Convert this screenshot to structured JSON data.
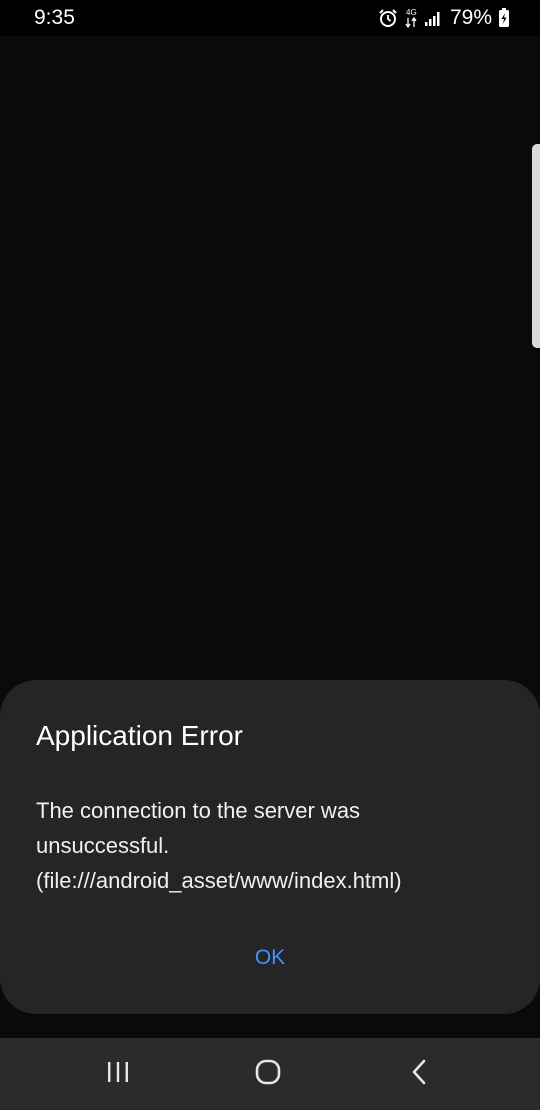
{
  "status_bar": {
    "time": "9:35",
    "battery_percent": "79%",
    "icons": [
      "alarm-icon",
      "data-transfer-icon",
      "signal-icon",
      "battery-charging-icon"
    ]
  },
  "dialog": {
    "title": "Application Error",
    "message_lines": [
      "The connection to the server was",
      "unsuccessful.",
      "(file:///android_asset/www/index.html)"
    ],
    "ok_label": "OK"
  },
  "nav_bar": {
    "icons": [
      "recents-icon",
      "home-icon",
      "back-icon"
    ]
  },
  "colors": {
    "background": "#0a0a0a",
    "dialog_background": "#252525",
    "accent": "#3e91ff",
    "nav_background": "#2b2b2b"
  }
}
